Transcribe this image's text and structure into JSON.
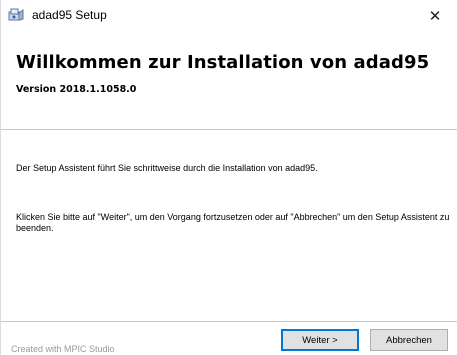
{
  "window": {
    "title": "adad95 Setup",
    "close_glyph": "✕"
  },
  "header": {
    "title": "Willkommen zur Installation von adad95",
    "version": "Version 2018.1.1058.0"
  },
  "body": {
    "paragraph1": "Der Setup Assistent führt Sie schrittweise durch die Installation von adad95.",
    "paragraph2": "Klicken Sie bitte auf \"Weiter\", um den Vorgang fortzusetzen oder auf \"Abbrechen\" um den Setup Assistent zu beenden."
  },
  "footer": {
    "watermark": "Created with MPIC Studio",
    "next_label": "Weiter >",
    "cancel_label": "Abbrechen"
  },
  "icons": {
    "app": "setup-app-icon",
    "close": "close-icon"
  },
  "colors": {
    "default_button_border": "#0078d7",
    "button_face": "#e1e1e1"
  }
}
